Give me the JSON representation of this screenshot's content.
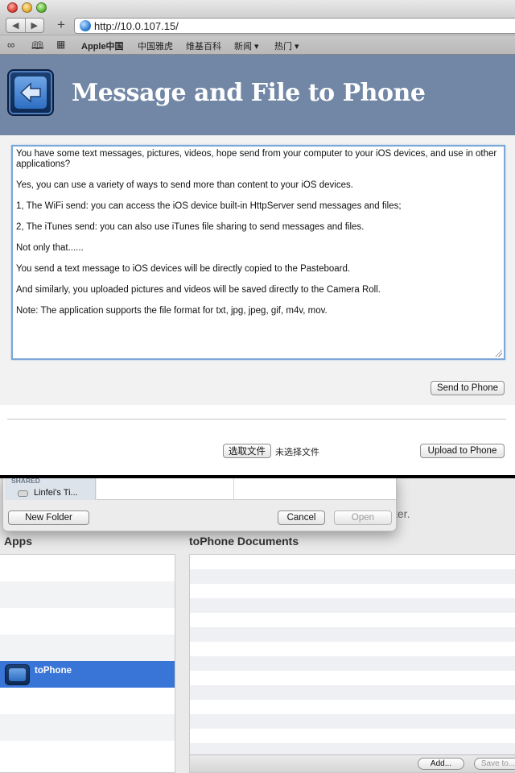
{
  "browser": {
    "nav_back": "◀",
    "nav_forward": "▶",
    "new_tab": "+",
    "url": "http://10.0.107.15/",
    "bookmarks": [
      "Apple中国",
      "中国雅虎",
      "维基百科",
      "新闻 ▾",
      "热门 ▾"
    ]
  },
  "page": {
    "title": "Message and File to Phone",
    "message_lines": [
      "You have some text messages, pictures, videos, hope send from your computer to your iOS devices, and use in other applications?",
      "Yes, you can use a variety of ways to send more than content to your iOS devices.",
      "1, The WiFi send: you can access the iOS device built-in HttpServer send messages and files;",
      "2, The iTunes send: you can also use iTunes file sharing to send messages and files.",
      "Not only that......",
      "You send a text message to iOS devices will be directly copied to the Pasteboard.",
      "And similarly, you uploaded pictures and videos will be saved directly to the Camera Roll.",
      "Note: The application supports the file format for txt, jpg, jpeg, gif, m4v, mov."
    ],
    "send_button": "Send to Phone",
    "choose_file_button": "选取文件",
    "no_file_text": "未选择文件",
    "upload_button": "Upload to Phone"
  },
  "dialog": {
    "shared_header": "SHARED",
    "shared_item": "Linfei's Ti...",
    "new_folder_button": "New Folder",
    "cancel_button": "Cancel",
    "open_button": "Open"
  },
  "itunes": {
    "background_text": "ter.",
    "apps_title": "Apps",
    "docs_title": "toPhone Documents",
    "selected_app": "toPhone",
    "add_button": "Add...",
    "save_button": "Save to..."
  },
  "colors": {
    "header_bg": "#7187a5",
    "selection": "#3875d7",
    "textarea_focus": "#7ca7d6"
  }
}
